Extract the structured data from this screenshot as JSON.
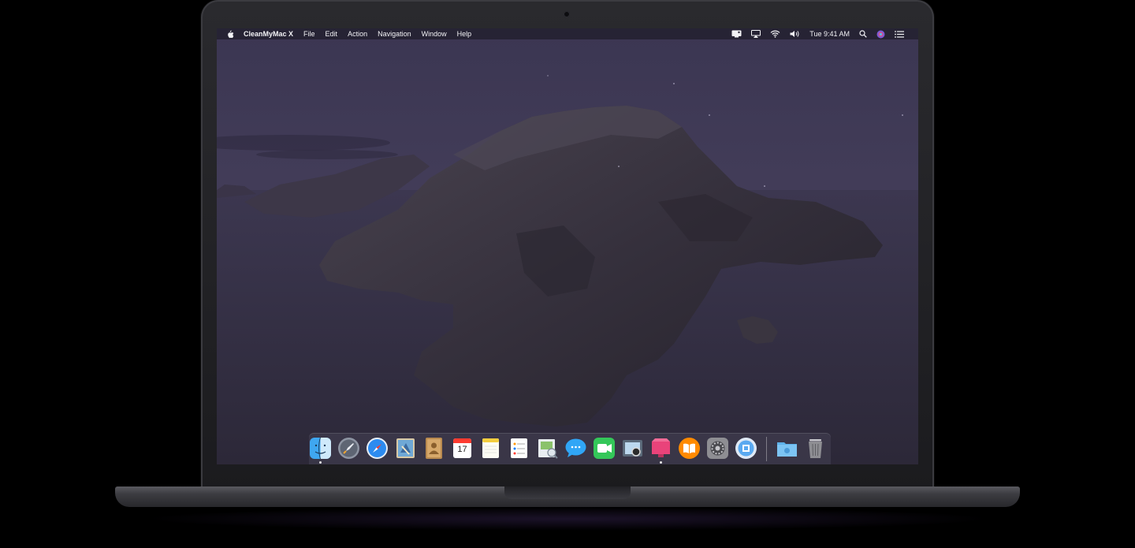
{
  "menubar": {
    "apple_icon": "apple-logo-icon",
    "app_name": "CleanMyMac X",
    "items": [
      "File",
      "Edit",
      "Action",
      "Navigation",
      "Window",
      "Help"
    ],
    "status_icons": [
      "cleanmymac-menu-icon",
      "airplay-icon",
      "wifi-icon",
      "volume-icon"
    ],
    "clock": "Tue 9:41 AM",
    "right_icons": [
      "spotlight-search-icon",
      "siri-icon",
      "notification-center-icon"
    ]
  },
  "dock": {
    "apps": [
      {
        "name": "finder-icon",
        "running": true
      },
      {
        "name": "launchpad-icon",
        "running": false
      },
      {
        "name": "safari-icon",
        "running": false
      },
      {
        "name": "mail-icon",
        "running": false
      },
      {
        "name": "contacts-icon",
        "running": false
      },
      {
        "name": "calendar-icon",
        "running": false,
        "label": "17"
      },
      {
        "name": "notes-icon",
        "running": false
      },
      {
        "name": "reminders-icon",
        "running": false
      },
      {
        "name": "preview-icon",
        "running": false
      },
      {
        "name": "messages-icon",
        "running": false
      },
      {
        "name": "facetime-icon",
        "running": false
      },
      {
        "name": "photo-booth-icon",
        "running": false
      },
      {
        "name": "cleanmymac-icon",
        "running": true
      },
      {
        "name": "books-icon",
        "running": false
      },
      {
        "name": "system-preferences-icon",
        "running": false
      },
      {
        "name": "app-store-icon",
        "running": false
      }
    ],
    "stack": [
      {
        "name": "downloads-folder-icon"
      },
      {
        "name": "trash-icon"
      }
    ]
  },
  "colors": {
    "sky": "#3a3550",
    "water": "#36324a",
    "land": "#2a2630",
    "dock_bg": "#464254"
  }
}
